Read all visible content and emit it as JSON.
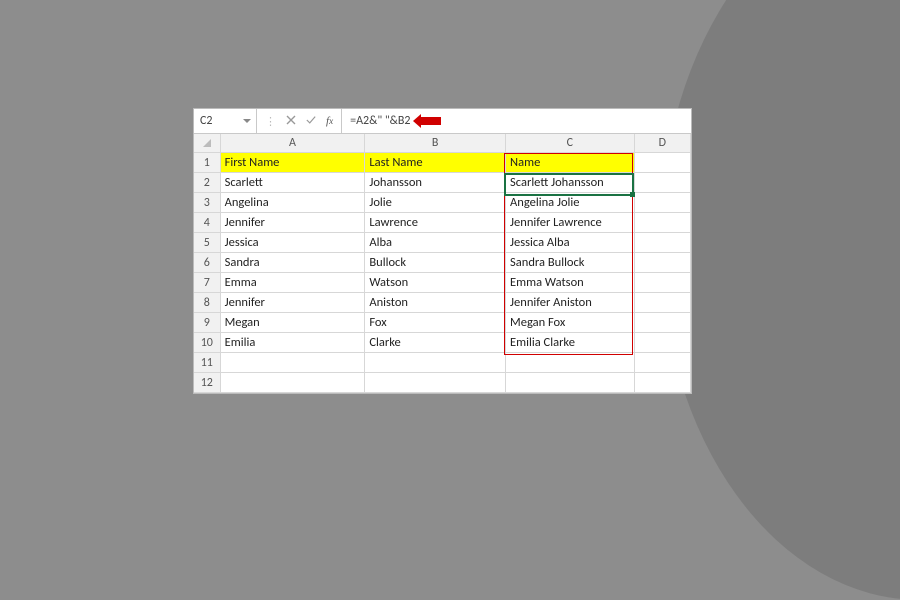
{
  "nameBox": "C2",
  "formula": "=A2&\" \"&B2",
  "columns": [
    "A",
    "B",
    "C",
    "D"
  ],
  "rowNumbers": [
    1,
    2,
    3,
    4,
    5,
    6,
    7,
    8,
    9,
    10,
    11,
    12
  ],
  "headers": {
    "a": "First Name",
    "b": "Last Name",
    "c": "Name"
  },
  "rows": [
    {
      "a": "Scarlett",
      "b": "Johansson",
      "c": "Scarlett Johansson"
    },
    {
      "a": "Angelina",
      "b": "Jolie",
      "c": "Angelina Jolie"
    },
    {
      "a": "Jennifer",
      "b": "Lawrence",
      "c": "Jennifer Lawrence"
    },
    {
      "a": "Jessica",
      "b": "Alba",
      "c": "Jessica  Alba"
    },
    {
      "a": "Sandra",
      "b": "Bullock",
      "c": "Sandra Bullock"
    },
    {
      "a": "Emma",
      "b": "Watson",
      "c": "Emma Watson"
    },
    {
      "a": "Jennifer",
      "b": "Aniston",
      "c": "Jennifer Aniston"
    },
    {
      "a": "Megan",
      "b": "Fox",
      "c": "Megan Fox"
    },
    {
      "a": "Emilia",
      "b": "Clarke",
      "c": "Emilia Clarke"
    }
  ],
  "colWidths": {
    "rowhdr": 26,
    "A": 144,
    "B": 140,
    "C": 128,
    "D": 56
  },
  "activeCell": "C2",
  "resultRange": "C1:C10"
}
